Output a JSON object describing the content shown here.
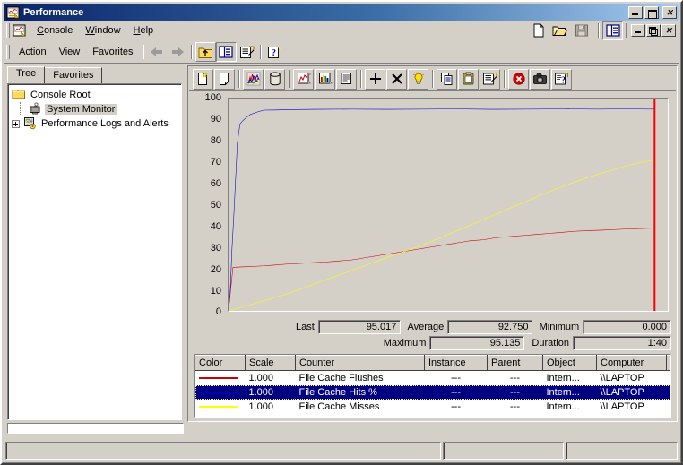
{
  "window": {
    "title": "Performance",
    "icon": "performance-monitor-icon",
    "buttons": {
      "minimize": "Minimize",
      "maximize": "Maximize",
      "close": "Close"
    }
  },
  "console_menu": {
    "items": [
      {
        "label": "Console",
        "accel": "C"
      },
      {
        "label": "Window",
        "accel": "W"
      },
      {
        "label": "Help",
        "accel": "H"
      }
    ],
    "toolbar": [
      {
        "name": "new-console-icon",
        "tooltip": "New"
      },
      {
        "name": "open-console-icon",
        "tooltip": "Open"
      },
      {
        "name": "save-console-icon",
        "tooltip": "Save"
      },
      {
        "name": "show-hide-console-tree-icon",
        "tooltip": "Show/Hide Console Tree"
      }
    ],
    "mdi_buttons": {
      "minimize": "Minimize",
      "restore": "Restore",
      "close": "Close"
    }
  },
  "action_bar": {
    "items": [
      {
        "label": "Action",
        "accel": "A"
      },
      {
        "label": "View",
        "accel": "V"
      },
      {
        "label": "Favorites",
        "accel": "F"
      }
    ],
    "toolbar": [
      {
        "name": "back-arrow-icon",
        "tooltip": "Back"
      },
      {
        "name": "forward-arrow-icon",
        "tooltip": "Forward"
      },
      {
        "name": "up-one-level-icon",
        "tooltip": "Up One Level"
      },
      {
        "name": "show-hide-tree-icon",
        "tooltip": "Show/Hide Console Tree",
        "pressed": true
      },
      {
        "name": "properties-icon",
        "tooltip": "Properties"
      },
      {
        "name": "help-icon",
        "tooltip": "Help"
      }
    ]
  },
  "tree_pane": {
    "tabs": [
      {
        "label": "Tree",
        "active": true
      },
      {
        "label": "Favorites",
        "active": false
      }
    ],
    "nodes": [
      {
        "label": "Console Root",
        "icon": "folder-icon",
        "level": 0,
        "expandable": false,
        "selected": false
      },
      {
        "label": "System Monitor",
        "icon": "system-monitor-icon",
        "level": 1,
        "expandable": false,
        "selected": true
      },
      {
        "label": "Performance Logs and Alerts",
        "icon": "performance-logs-icon",
        "level": 1,
        "expandable": true,
        "selected": false
      }
    ]
  },
  "graph_toolbar": {
    "buttons": [
      {
        "name": "new-counter-set-icon",
        "tooltip": "New Counter Set"
      },
      {
        "name": "clear-display-icon",
        "tooltip": "Clear Display"
      },
      {
        "name": "view-current-activity-icon",
        "tooltip": "View Current Activity"
      },
      {
        "name": "view-log-file-data-icon",
        "tooltip": "View Log File Data"
      },
      {
        "name": "view-graph-icon",
        "tooltip": "View Graph"
      },
      {
        "name": "view-histogram-icon",
        "tooltip": "View Histogram"
      },
      {
        "name": "view-report-icon",
        "tooltip": "View Report"
      },
      {
        "name": "add-counter-icon",
        "tooltip": "Add"
      },
      {
        "name": "delete-counter-icon",
        "tooltip": "Delete"
      },
      {
        "name": "highlight-icon",
        "tooltip": "Highlight"
      },
      {
        "name": "copy-properties-icon",
        "tooltip": "Copy Properties"
      },
      {
        "name": "paste-counter-list-icon",
        "tooltip": "Paste Counter List"
      },
      {
        "name": "properties-icon",
        "tooltip": "Properties"
      },
      {
        "name": "freeze-display-icon",
        "tooltip": "Freeze Display"
      },
      {
        "name": "update-data-icon",
        "tooltip": "Update Data"
      },
      {
        "name": "help-icon",
        "tooltip": "Help"
      }
    ]
  },
  "chart_data": {
    "type": "line",
    "title": "",
    "xlabel": "",
    "ylabel": "",
    "ylim": [
      0,
      100
    ],
    "xlim": [
      0,
      100
    ],
    "grid": false,
    "yticks": [
      100,
      90,
      80,
      70,
      60,
      50,
      40,
      30,
      20,
      10,
      0
    ],
    "legend_position": "bottom-table",
    "timebar_x_pct": 97.0,
    "timebar_color": "#ff0000",
    "series": [
      {
        "name": "File Cache Flushes",
        "color": "#cc0000",
        "x": [
          0,
          1,
          2,
          4,
          6,
          8,
          10,
          13,
          16,
          19,
          22,
          25,
          28,
          31,
          34,
          37,
          40,
          43,
          46,
          49,
          52,
          55,
          58,
          61,
          64,
          67,
          70,
          73,
          76,
          79,
          82,
          85,
          88,
          91,
          94,
          97
        ],
        "y": [
          0,
          20.5,
          20.6,
          20.8,
          21.0,
          21.2,
          21.5,
          22.0,
          22.3,
          22.7,
          23.0,
          23.5,
          24.0,
          25.0,
          26.0,
          27.0,
          28.0,
          29.0,
          30.0,
          31.0,
          32.0,
          33.0,
          33.5,
          34.5,
          35.0,
          35.5,
          36.0,
          36.5,
          37.0,
          37.5,
          37.8,
          38.0,
          38.3,
          38.6,
          38.8,
          39.0
        ]
      },
      {
        "name": "File Cache Hits %",
        "color": "#0000cc",
        "x": [
          0,
          0.4,
          0.8,
          1.2,
          1.6,
          2.0,
          2.6,
          3.2,
          4.0,
          5.0,
          6.5,
          8,
          11,
          15,
          20,
          28,
          36,
          44,
          52,
          60,
          68,
          76,
          84,
          90,
          97
        ],
        "y": [
          0,
          10,
          30,
          45,
          62,
          79,
          88,
          89.5,
          91,
          92.5,
          93.6,
          94.5,
          94.6,
          94.8,
          94.9,
          95.0,
          94.9,
          95.0,
          95.1,
          94.9,
          95.0,
          95.1,
          95.0,
          95.1,
          95.0
        ]
      },
      {
        "name": "File Cache Misses",
        "color": "#ffff00",
        "x": [
          0,
          2,
          6,
          10,
          14,
          18,
          22,
          26,
          30,
          34,
          38,
          42,
          46,
          50,
          54,
          58,
          62,
          66,
          70,
          74,
          78,
          82,
          86,
          90,
          94,
          97
        ],
        "y": [
          0,
          1.2,
          3.5,
          6.0,
          8.5,
          11.5,
          14.5,
          17.5,
          20.5,
          23.5,
          26.5,
          29.5,
          32.5,
          36.0,
          39.5,
          43.0,
          46.5,
          50.0,
          53.5,
          57.0,
          60.0,
          63.0,
          65.5,
          68.0,
          70.0,
          71.0
        ]
      }
    ]
  },
  "stats": {
    "rows": [
      [
        {
          "label": "Last",
          "value": "95.017"
        },
        {
          "label": "Average",
          "value": "92.750"
        },
        {
          "label": "Minimum",
          "value": "0.000"
        }
      ],
      [
        {
          "label": "",
          "value": ""
        },
        {
          "label": "Maximum",
          "value": "95.135"
        },
        {
          "label": "Duration",
          "value": "1:40"
        }
      ]
    ]
  },
  "counter_legend": {
    "columns": [
      "Color",
      "Scale",
      "Counter",
      "Instance",
      "Parent",
      "Object",
      "Computer",
      ""
    ],
    "rows": [
      {
        "color": "#cc0000",
        "scale": "1.000",
        "counter": "File Cache Flushes",
        "instance": "---",
        "parent": "---",
        "object": "Intern...",
        "computer": "\\\\LAPTOP",
        "selected": false
      },
      {
        "color": "#0000cc",
        "scale": "1.000",
        "counter": "File Cache Hits %",
        "instance": "---",
        "parent": "---",
        "object": "Intern...",
        "computer": "\\\\LAPTOP",
        "selected": true
      },
      {
        "color": "#ffff00",
        "scale": "1.000",
        "counter": "File Cache Misses",
        "instance": "---",
        "parent": "---",
        "object": "Intern...",
        "computer": "\\\\LAPTOP",
        "selected": false
      }
    ]
  },
  "status_bar": {
    "panels": [
      "",
      "",
      ""
    ]
  },
  "colors": {
    "face": "#d4d0c8",
    "title_start": "#0a246a",
    "title_end": "#a6caf0",
    "selection": "#000080",
    "series_red": "#cc0000",
    "series_blue": "#0000cc",
    "series_yellow": "#ffff00",
    "timebar": "#ff0000"
  }
}
